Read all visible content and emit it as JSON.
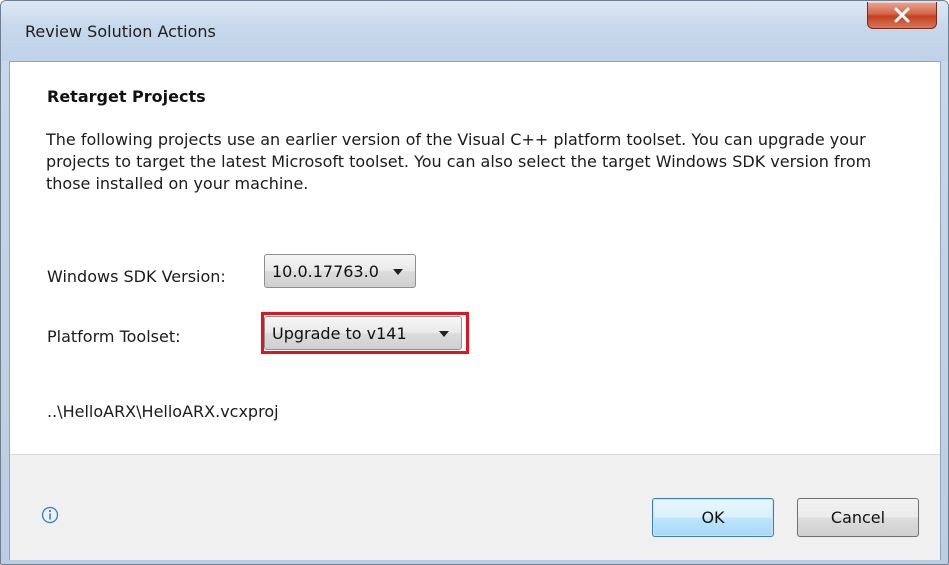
{
  "window": {
    "title": "Review Solution Actions"
  },
  "content": {
    "heading": "Retarget Projects",
    "description": "The following projects use an earlier version of the Visual C++ platform toolset.  You can upgrade your projects to target the latest Microsoft toolset.  You can also select the target Windows SDK version from those installed on your machine.",
    "sdk_label": "Windows SDK Version:",
    "sdk_value": "10.0.17763.0",
    "toolset_label": "Platform Toolset:",
    "toolset_value": "Upgrade to v141",
    "project_path": "..\\HelloARX\\HelloARX.vcxproj"
  },
  "footer": {
    "ok_label": "OK",
    "cancel_label": "Cancel"
  },
  "icons": {
    "close": "close-icon",
    "info": "info-icon",
    "dropdown": "chevron-down-icon"
  },
  "colors": {
    "highlight_border": "#e3141f",
    "close_button": "#c4401f",
    "default_button_border": "#3c7fb1"
  }
}
